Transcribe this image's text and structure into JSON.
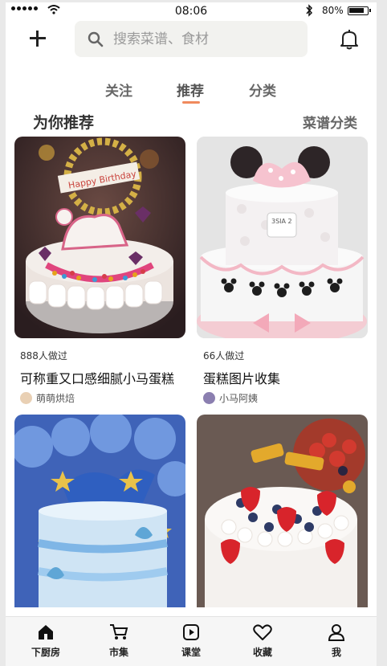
{
  "status_bar": {
    "time": "08:06",
    "battery_pct": "80%",
    "battery_level": 0.8,
    "wifi_icon": "wifi-icon",
    "bluetooth_icon": "bluetooth-icon"
  },
  "header": {
    "add_icon": "plus-icon",
    "search_placeholder": "搜索菜谱、食材",
    "search_icon": "search-icon",
    "bell_icon": "bell-icon"
  },
  "tabs": [
    {
      "label": "关注",
      "active": false
    },
    {
      "label": "推荐",
      "active": true
    },
    {
      "label": "分类",
      "active": false
    }
  ],
  "accent_color": "#f08a5d",
  "section": {
    "title": "为你推荐",
    "link": "菜谱分类"
  },
  "recipes": [
    {
      "made": "888人做过",
      "title": "可称重又口感细腻小马蛋糕",
      "author": "萌萌烘焙",
      "image_desc": "pink birthday cake with carousel horse"
    },
    {
      "made": "66人做过",
      "title": "蛋糕图片收集",
      "author": "小马阿姨",
      "image_desc": "minnie mouse two tier fondant cake"
    },
    {
      "image_desc": "blue mermaid birthday cake with balloons"
    },
    {
      "image_desc": "strawberry blueberry cream cake"
    }
  ],
  "card_images": {
    "img1_text": "Happy Birthday",
    "img2_text": "3SIA 2"
  },
  "bottom_nav": [
    {
      "label": "下厨房",
      "icon": "home-icon"
    },
    {
      "label": "市集",
      "icon": "cart-icon"
    },
    {
      "label": "课堂",
      "icon": "play-icon"
    },
    {
      "label": "收藏",
      "icon": "heart-icon"
    },
    {
      "label": "我",
      "icon": "person-icon"
    }
  ]
}
